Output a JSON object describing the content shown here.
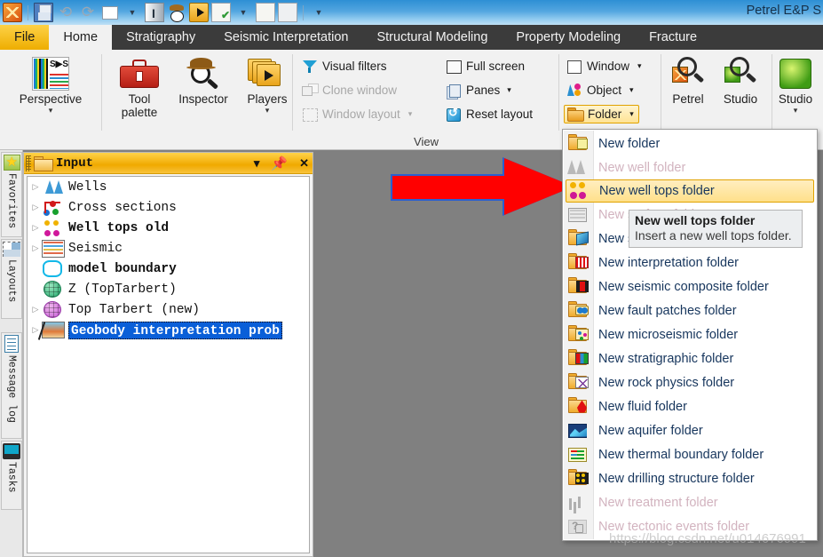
{
  "window": {
    "title": "Petrel E&P S"
  },
  "quick_access": {
    "icons": [
      {
        "name": "petrel-logo-icon",
        "label": "Petrel"
      },
      {
        "name": "save-icon",
        "label": "Save"
      },
      {
        "name": "undo-icon",
        "label": "Undo"
      },
      {
        "name": "redo-icon",
        "label": "Redo"
      },
      {
        "name": "new-window-icon",
        "label": "New window"
      },
      {
        "name": "new-window-dropdown-caret-icon",
        "label": "New window options"
      },
      {
        "name": "vertical-scale-icon",
        "label": "Vertical scale"
      },
      {
        "name": "inspector-icon",
        "label": "Inspector"
      },
      {
        "name": "player-icon",
        "label": "Player"
      },
      {
        "name": "process-check-icon",
        "label": "Process"
      },
      {
        "name": "process-dropdown-caret-icon",
        "label": "Process options"
      },
      {
        "name": "copy-icon",
        "label": "Copy"
      },
      {
        "name": "paste-icon",
        "label": "Paste"
      },
      {
        "name": "qat-overflow-caret-icon",
        "label": "More commands"
      }
    ]
  },
  "ribbon": {
    "tabs": [
      {
        "label": "File",
        "state": "file"
      },
      {
        "label": "Home",
        "state": "active"
      },
      {
        "label": "Stratigraphy",
        "state": "normal"
      },
      {
        "label": "Seismic Interpretation",
        "state": "normal"
      },
      {
        "label": "Structural Modeling",
        "state": "normal"
      },
      {
        "label": "Property Modeling",
        "state": "normal"
      },
      {
        "label": "Fracture",
        "state": "normal"
      }
    ],
    "groups": {
      "perspective": {
        "label": "Perspective",
        "caret": "▾",
        "icon": "perspective-icon"
      },
      "tools": {
        "tool_palette": "Tool\npalette",
        "tool_palette_line1": "Tool",
        "tool_palette_line2": "palette",
        "inspector": "Inspector",
        "players": "Players",
        "players_caret": "▾"
      },
      "view": {
        "label": "View",
        "items": [
          {
            "label": "Visual filters",
            "icon": "visual-filters-icon",
            "enabled": true
          },
          {
            "label": "Clone window",
            "icon": "clone-window-icon",
            "enabled": false
          },
          {
            "label": "Window layout",
            "icon": "window-layout-icon",
            "enabled": false,
            "caret": "▾"
          },
          {
            "label": "Full screen",
            "icon": "full-screen-icon",
            "enabled": true
          },
          {
            "label": "Panes",
            "icon": "panes-icon",
            "enabled": true,
            "caret": "▾"
          },
          {
            "label": "Reset layout",
            "icon": "reset-layout-icon",
            "enabled": true
          }
        ]
      },
      "insert": {
        "items": [
          {
            "label": "Window",
            "icon": "window-icon",
            "caret": "▾"
          },
          {
            "label": "Object",
            "icon": "object-icon",
            "caret": "▾"
          },
          {
            "label": "Folder",
            "icon": "folder-icon",
            "caret": "▾",
            "active": true
          }
        ]
      },
      "search": {
        "petrel": "Petrel",
        "studio": "Studio"
      },
      "studio_group": {
        "label": "Studio",
        "caret": "▾"
      }
    }
  },
  "dock_strip": {
    "tabs": [
      {
        "label": "Favorites",
        "icon": "favorites-star-icon"
      },
      {
        "label": "Layouts",
        "icon": "layouts-icon"
      },
      {
        "label": "Message log",
        "icon": "message-log-icon"
      },
      {
        "label": "Tasks",
        "icon": "tasks-icon"
      }
    ]
  },
  "input_panel": {
    "title": "Input",
    "folder_icon": "folder-icon",
    "buttons": [
      {
        "name": "panel-menu-caret",
        "glyph": "▾"
      },
      {
        "name": "panel-pin",
        "glyph": "⚇"
      },
      {
        "name": "panel-close",
        "glyph": "✕"
      }
    ],
    "tree": [
      {
        "label": "Wells",
        "icon": "wells-icon",
        "expandable": true,
        "bold": false,
        "selected": false
      },
      {
        "label": "Cross sections",
        "icon": "cross-sections-icon",
        "expandable": true,
        "bold": false,
        "selected": false
      },
      {
        "label": "Well tops old",
        "icon": "well-tops-icon",
        "expandable": true,
        "bold": true,
        "selected": false
      },
      {
        "label": "Seismic",
        "icon": "seismic-icon",
        "expandable": true,
        "bold": false,
        "selected": false
      },
      {
        "label": "model boundary",
        "icon": "boundary-polygon-icon",
        "expandable": false,
        "bold": true,
        "selected": false
      },
      {
        "label": "Z (TopTarbert)",
        "icon": "surface-grid-icon",
        "expandable": false,
        "bold": false,
        "selected": false
      },
      {
        "label": "Top Tarbert (new)",
        "icon": "surface-grid-pink-icon",
        "expandable": true,
        "bold": false,
        "selected": false
      },
      {
        "label": "Geobody interpretation prob",
        "icon": "geobody-interpretation-icon",
        "expandable": true,
        "bold": true,
        "selected": true
      }
    ]
  },
  "folder_menu": {
    "items": [
      {
        "label": "New folder",
        "icon": "new-folder-icon",
        "enabled": true,
        "highlighted": false
      },
      {
        "label": "New well folder",
        "icon": "new-well-folder-icon",
        "enabled": false,
        "highlighted": false
      },
      {
        "label": "New well tops folder",
        "icon": "new-well-tops-folder-icon",
        "enabled": true,
        "highlighted": true
      },
      {
        "label": "New surface folder",
        "icon": "new-surface-folder-icon",
        "enabled": false,
        "highlighted": false
      },
      {
        "label": "New seismic folder",
        "icon": "new-seismic-folder-icon",
        "enabled": true,
        "highlighted": false
      },
      {
        "label": "New interpretation folder",
        "icon": "new-interpretation-folder-icon",
        "enabled": true,
        "highlighted": false
      },
      {
        "label": "New seismic composite folder",
        "icon": "new-seismic-composite-folder-icon",
        "enabled": true,
        "highlighted": false
      },
      {
        "label": "New fault patches folder",
        "icon": "new-fault-patches-folder-icon",
        "enabled": true,
        "highlighted": false
      },
      {
        "label": "New microseismic folder",
        "icon": "new-microseismic-folder-icon",
        "enabled": true,
        "highlighted": false
      },
      {
        "label": "New stratigraphic folder",
        "icon": "new-stratigraphic-folder-icon",
        "enabled": true,
        "highlighted": false
      },
      {
        "label": "New rock physics folder",
        "icon": "new-rock-physics-folder-icon",
        "enabled": true,
        "highlighted": false,
        "accesskey": "r"
      },
      {
        "label": "New fluid folder",
        "icon": "new-fluid-folder-icon",
        "enabled": true,
        "highlighted": false
      },
      {
        "label": "New aquifer folder",
        "icon": "new-aquifer-folder-icon",
        "enabled": true,
        "highlighted": false
      },
      {
        "label": "New thermal boundary folder",
        "icon": "new-thermal-boundary-folder-icon",
        "enabled": true,
        "highlighted": false
      },
      {
        "label": "New drilling structure folder",
        "icon": "new-drilling-structure-folder-icon",
        "enabled": true,
        "highlighted": false
      },
      {
        "label": "New treatment folder",
        "icon": "new-treatment-folder-icon",
        "enabled": false,
        "highlighted": false
      },
      {
        "label": "New tectonic events folder",
        "icon": "new-tectonic-events-folder-icon",
        "enabled": false,
        "highlighted": false
      }
    ]
  },
  "tooltip": {
    "title": "New well tops folder",
    "body": "Insert a new well tops folder."
  },
  "annotation": {
    "arrow": "red-arrow-pointer"
  },
  "watermark": {
    "text": "https://blog.csdn.net/u014676991"
  },
  "colors": {
    "accent_yellow": "#f0b400",
    "tab_bar": "#3b3b3b",
    "ribbon_bg": "#f1f1f1",
    "workspace_bg": "#808080",
    "menu_text": "#17365d",
    "menu_disabled": "#d2b3bf",
    "selection_blue": "#0a5fd8",
    "arrow_red": "#ff0000",
    "arrow_outline_blue": "#2a5fd0"
  }
}
